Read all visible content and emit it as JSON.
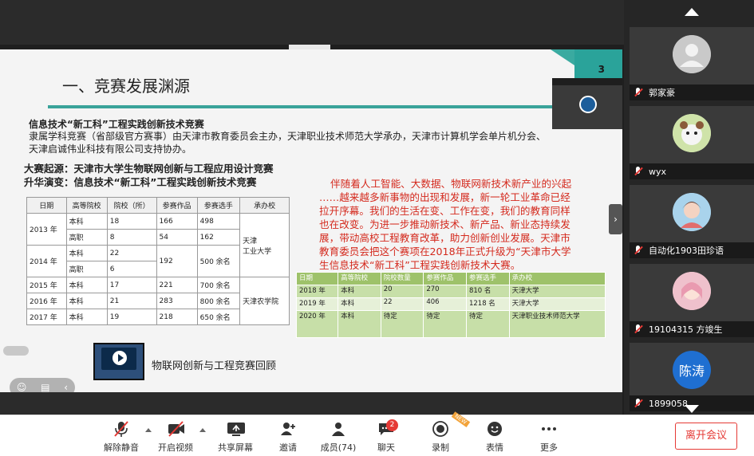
{
  "slide": {
    "page_number": "3",
    "title": "一、竞赛发展渊源",
    "share_tag": "",
    "subtitle": "信息技术“新工科”工程实践创新技术竞赛",
    "desc_line1": "隶属学科竞赛（省部级官方赛事）由天津市教育委员会主办，天津职业技术师范大学承办，天津市计算机学会单片机分会、",
    "desc_line2": "天津启诚伟业科技有限公司支持协办。",
    "origin_line1": "大赛起源：天津市大学生物联网创新与工程应用设计竞赛",
    "origin_line2": "升华演变：信息技术“新工科”工程实践创新技术竞赛",
    "red_paragraph": "伴随着人工智能、大数据、物联网新技术新产业的兴起 ……越来越多新事物的出现和发展，新一轮工业革命已经拉开序幕。我们的生活在变、工作在变，我们的教育同样也在改变。为进一步推动新技术、新产品、新业态持续发展，带动高校工程教育改革，助力创新创业发展。天津市教育委员会把这个赛项在2018年正式升级为“天津市大学生信息技术“新工科”工程实践创新技术大赛。",
    "video_caption": "物联网创新与工程竞赛回顾",
    "mini_badge": ""
  },
  "table1": {
    "headers": [
      "日期",
      "高等院校",
      "院校（所）",
      "参赛作品",
      "参赛选手",
      "承办校"
    ],
    "rows": [
      {
        "year": "2013 年",
        "type": "本科",
        "count": "18",
        "works": "166",
        "players": "498",
        "host": ""
      },
      {
        "year": "",
        "type": "高职",
        "count": "8",
        "works": "54",
        "players": "162",
        "host": "天津"
      },
      {
        "year": "2014 年",
        "type": "本科",
        "count": "22",
        "works": "192",
        "players": "500 余名",
        "host": "工业大学"
      },
      {
        "year": "",
        "type": "高职",
        "count": "6",
        "works": "",
        "players": "",
        "host": ""
      },
      {
        "year": "2015 年",
        "type": "本科",
        "count": "17",
        "works": "221",
        "players": "700 余名",
        "host": ""
      },
      {
        "year": "2016 年",
        "type": "本科",
        "count": "21",
        "works": "283",
        "players": "800 余名",
        "host": "天津农学院"
      },
      {
        "year": "2017 年",
        "type": "本科",
        "count": "19",
        "works": "218",
        "players": "650 余名",
        "host": ""
      }
    ]
  },
  "table2": {
    "headers": [
      "日期",
      "高等院校",
      "院校数量",
      "参赛作品",
      "参赛选手",
      "承办校"
    ],
    "rows": [
      {
        "year": "2018 年",
        "type": "本科",
        "count": "20",
        "works": "270",
        "players": "810 名",
        "host": "天津大学"
      },
      {
        "year": "2019 年",
        "type": "本科",
        "count": "22",
        "works": "406",
        "players": "1218 名",
        "host": "天津大学"
      },
      {
        "year": "2020 年",
        "type": "本科",
        "count": "待定",
        "works": "待定",
        "players": "待定",
        "host": "天津职业技术师范大学"
      }
    ]
  },
  "self_preview": {
    "bar_text": "",
    "foot_text": ""
  },
  "participants": [
    {
      "name": "郭家豪"
    },
    {
      "name": "wyx"
    },
    {
      "name": "自动化1903田珍语"
    },
    {
      "name": "19104315 方竣生"
    },
    {
      "name": "1899058",
      "avatar_text": "陈涛"
    }
  ],
  "toolbar": {
    "mute": "解除静音",
    "video": "开启视频",
    "share": "共享屏幕",
    "invite": "邀请",
    "members": "成员(74)",
    "chat": "聊天",
    "chat_badge": "2",
    "record": "录制",
    "record_tag": "NEW",
    "emoji": "表情",
    "more": "更多",
    "leave": "离开会议"
  },
  "colors": {
    "accent_teal": "#3aa39a",
    "red_text": "#d42a1e",
    "leave_red": "#e53935",
    "table2_bg": "#c7dfa8"
  }
}
